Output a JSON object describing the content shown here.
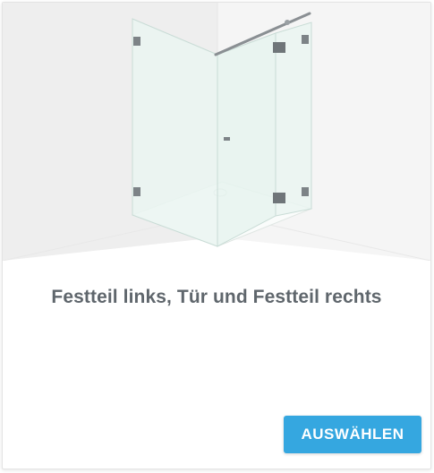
{
  "option": {
    "title": "Festteil links, Tür und Festteil rechts",
    "select_label": "AUSWÄHLEN",
    "illustration_icon": "shower-enclosure-icon"
  },
  "colors": {
    "button_background": "#35a7e0",
    "button_text": "#ffffff",
    "title_text": "#5f666c",
    "room_wall": "#f2f2f2",
    "glass": "#e9f4f1"
  }
}
